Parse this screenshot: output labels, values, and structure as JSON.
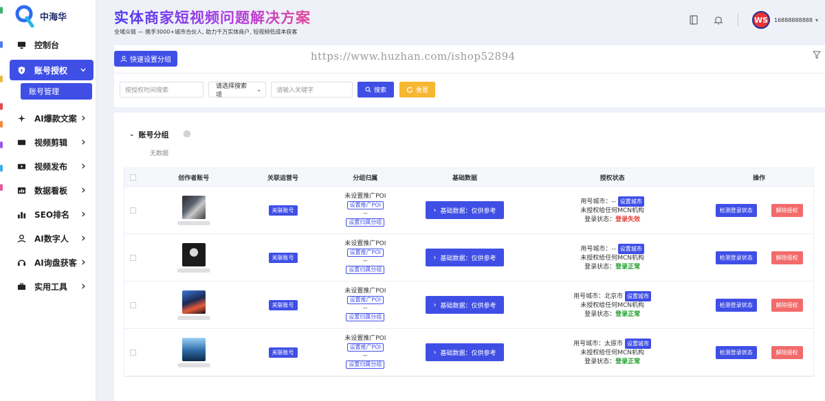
{
  "sidebar": {
    "brand": "中海华",
    "items": [
      {
        "label": "控制台",
        "icon": "monitor-icon"
      },
      {
        "label": "账号授权",
        "icon": "shield-icon"
      },
      {
        "label": "AI爆款文案",
        "icon": "sparkle-icon"
      },
      {
        "label": "视频剪辑",
        "icon": "video-edit-icon"
      },
      {
        "label": "视频发布",
        "icon": "video-publish-icon"
      },
      {
        "label": "数据看板",
        "icon": "dashboard-icon"
      },
      {
        "label": "SEO排名",
        "icon": "bar-chart-icon"
      },
      {
        "label": "AI数字人",
        "icon": "user-icon"
      },
      {
        "label": "AI询盘获客",
        "icon": "headset-icon"
      },
      {
        "label": "实用工具",
        "icon": "toolbox-icon"
      }
    ],
    "sub_item": "账号管理"
  },
  "header": {
    "banner": "实体商家短视频问题解决方案",
    "tagline": "全域众链 — 携手3000+城市合伙人, 助力千万实体商户, 短视频低成本获客",
    "username": "16888888888",
    "avatar_text": "WS"
  },
  "toolbar": {
    "quick_group_label": "快速设置分组",
    "watermark": "https://www.huzhan.com/ishop52894"
  },
  "search": {
    "time_placeholder": "按授权时间搜索",
    "select_value": "请选择搜索项",
    "keyword_placeholder": "请输入关键字",
    "search_label": "搜索",
    "reset_label": "重置"
  },
  "group": {
    "title": "账号分组",
    "empty": "无数据"
  },
  "table": {
    "headers": [
      "创作者账号",
      "关联运营号",
      "分组归属",
      "基础数据",
      "授权状态",
      "操作"
    ],
    "rows": [
      {
        "link": "关联账号",
        "poi": "未设置推广POI",
        "set_poi": "设置推广POI",
        "dash": "--",
        "set_group": "设置归属分组",
        "basic": "基础数据：仅供参考",
        "city_label": "用号城市：",
        "city": "--",
        "set_city": "设置城市",
        "mcn": "未授权给任何MCN机构",
        "login_label": "登录状态：",
        "login": "登录失效",
        "login_ok": false,
        "check": "检测登录状态",
        "unbind": "解除授权"
      },
      {
        "link": "关联账号",
        "poi": "未设置推广POI",
        "set_poi": "设置推广POI",
        "dash": "--",
        "set_group": "设置归属分组",
        "basic": "基础数据：仅供参考",
        "city_label": "用号城市：",
        "city": "--",
        "set_city": "设置城市",
        "mcn": "未授权给任何MCN机构",
        "login_label": "登录状态：",
        "login": "登录正常",
        "login_ok": true,
        "check": "检测登录状态",
        "unbind": "解除授权"
      },
      {
        "link": "关联账号",
        "poi": "未设置推广POI",
        "set_poi": "设置推广POI",
        "dash": "--",
        "set_group": "设置归属分组",
        "basic": "基础数据：仅供参考",
        "city_label": "用号城市：",
        "city": "北京市",
        "set_city": "设置城市",
        "mcn": "未授权给任何MCN机构",
        "login_label": "登录状态：",
        "login": "登录正常",
        "login_ok": true,
        "check": "检测登录状态",
        "unbind": "解除授权"
      },
      {
        "link": "关联账号",
        "poi": "未设置推广POI",
        "set_poi": "设置推广POI",
        "dash": "--",
        "set_group": "设置归属分组",
        "basic": "基础数据：仅供参考",
        "city_label": "用号城市：",
        "city": "太原市",
        "set_city": "设置城市",
        "mcn": "未授权给任何MCN机构",
        "login_label": "登录状态：",
        "login": "登录正常",
        "login_ok": true,
        "check": "检测登录状态",
        "unbind": "解除授权"
      }
    ]
  },
  "colors": {
    "primary": "#3f4fe6",
    "reset": "#f7b731",
    "danger": "#f26b6b",
    "status_fail": "#e53935",
    "status_ok": "#1e9d2a"
  }
}
